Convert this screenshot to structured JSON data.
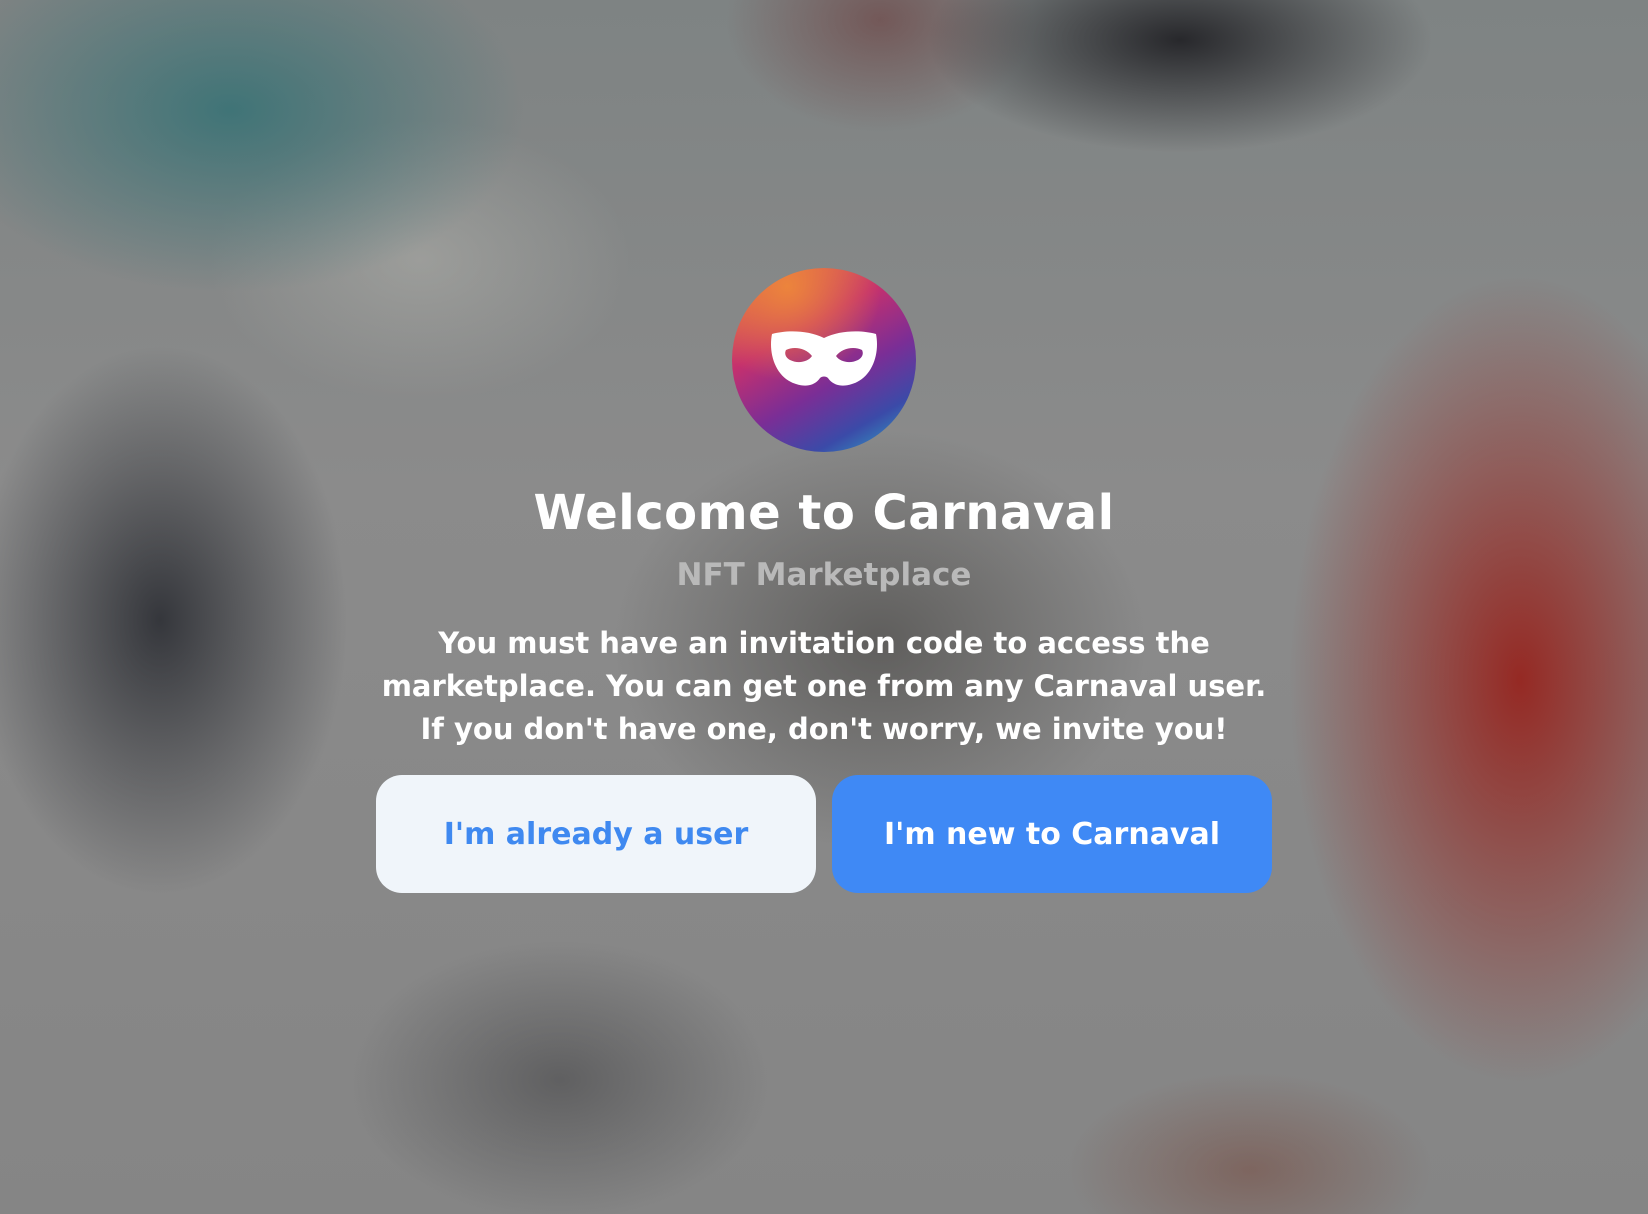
{
  "app": {
    "logo_icon": "carnival-mask-icon",
    "title": "Welcome to Carnaval",
    "subtitle": "NFT Marketplace",
    "description": "You must have an invitation code to access the marketplace. You can get one from any Carnaval user. If you don't have one, don't worry, we invite you!"
  },
  "actions": {
    "existing_user_label": "I'm already a user",
    "new_user_label": "I'm new to Carnaval"
  },
  "colors": {
    "primary": "#3f89f5",
    "secondary_bg": "#f0f5fa",
    "subtitle": "#b9b9b9",
    "text": "#ffffff"
  }
}
